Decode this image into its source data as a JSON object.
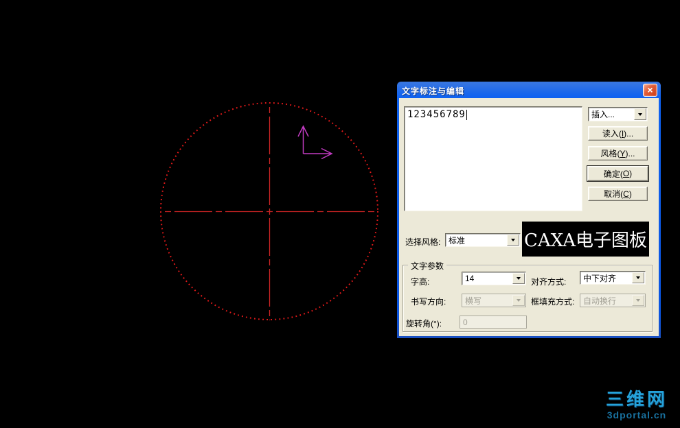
{
  "window": {
    "title": "文字标注与编辑",
    "close_icon": "×"
  },
  "editor": {
    "text": "123456789"
  },
  "insert_combo": {
    "label": "插入..."
  },
  "buttons": {
    "read": {
      "pre": "读入(",
      "key": "I",
      "post": ")..."
    },
    "style": {
      "pre": "风格(",
      "key": "Y",
      "post": ")..."
    },
    "ok": {
      "pre": "确定(",
      "key": "O",
      "post": ")"
    },
    "cancel": {
      "pre": "取消(",
      "key": "C",
      "post": ")"
    }
  },
  "style_select": {
    "label": "选择风格:",
    "value": "标准"
  },
  "text_params": {
    "group_title": "文字参数",
    "char_height": {
      "label": "字高:",
      "value": "14"
    },
    "alignment": {
      "label": "对齐方式:",
      "value": "中下对齐"
    },
    "direction": {
      "label": "书写方向:",
      "value": "横写",
      "enabled": false
    },
    "fill_mode": {
      "label": "框填充方式:",
      "value": "自动换行",
      "enabled": false
    },
    "rotation": {
      "label": "旋转角(°):",
      "value": "0",
      "enabled": false
    }
  },
  "watermarks": {
    "caxa": "CAXA电子图板",
    "site_name": "三维网",
    "site_url": "3dportal.cn",
    "site_color": "#25a2da",
    "site_url_color": "#1e86bd"
  },
  "drawing": {
    "background": "#000000",
    "circle_color": "#e81a1a",
    "centerline_color": "#c92424",
    "axis_marker_color": "#c43cc4"
  }
}
